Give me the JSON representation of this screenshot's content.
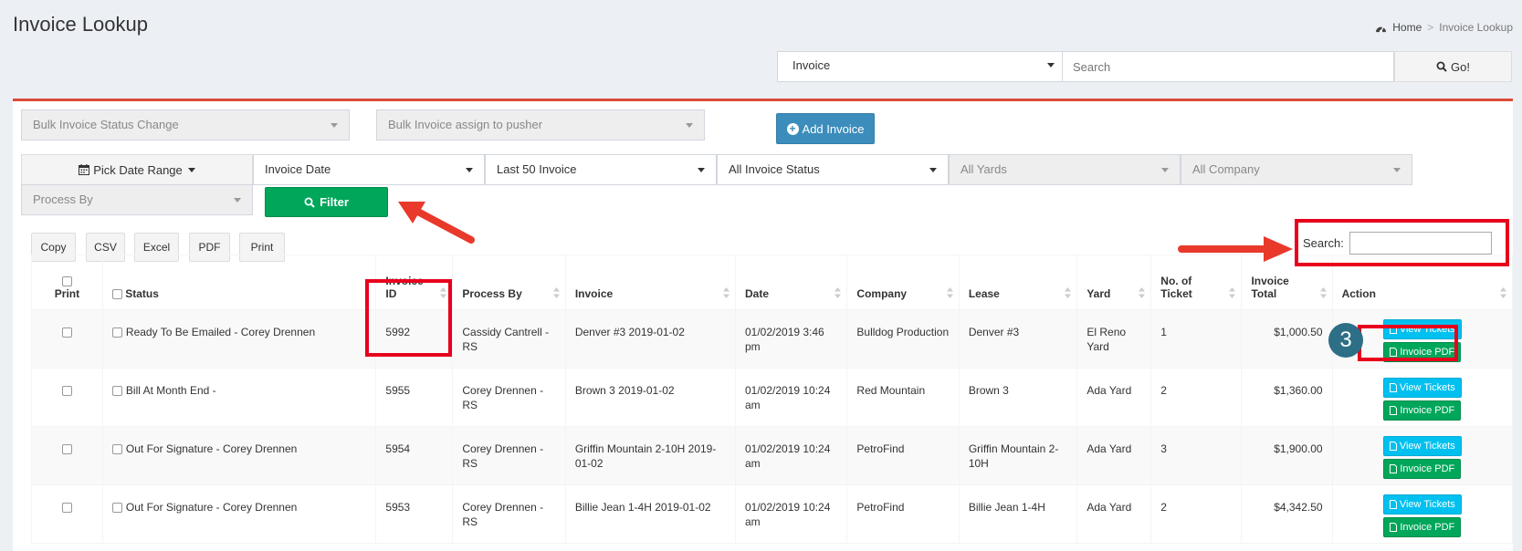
{
  "page": {
    "title": "Invoice Lookup"
  },
  "breadcrumb": {
    "home": "Home",
    "current": "Invoice Lookup"
  },
  "top_search": {
    "type_value": "Invoice",
    "placeholder": "Search",
    "go_label": "Go!"
  },
  "filters": {
    "bulk_status": "Bulk Invoice Status Change",
    "bulk_assign": "Bulk Invoice assign to pusher",
    "add_invoice": "Add Invoice",
    "pick_date": "Pick Date Range",
    "date_field": "Invoice Date",
    "limit": "Last 50 Invoice",
    "status": "All Invoice Status",
    "yards": "All Yards",
    "company": "All Company",
    "process_by": "Process By",
    "filter_label": "Filter"
  },
  "export_buttons": [
    "Copy",
    "CSV",
    "Excel",
    "PDF",
    "Print"
  ],
  "table_search": {
    "label": "Search:"
  },
  "table": {
    "headers": {
      "print": "Print",
      "status": "Status",
      "invoice_id_1": "Invoice",
      "invoice_id_2": "ID",
      "process_by": "Process By",
      "invoice": "Invoice",
      "date": "Date",
      "company": "Company",
      "lease": "Lease",
      "yard": "Yard",
      "tickets_1": "No. of",
      "tickets_2": "Ticket",
      "total_1": "Invoice",
      "total_2": "Total",
      "action": "Action"
    },
    "rows": [
      {
        "status": "Ready To Be Emailed - Corey Drennen",
        "id": "5992",
        "process_by": "Cassidy Cantrell - RS",
        "invoice": "Denver #3 2019-01-02",
        "date": "01/02/2019 3:46 pm",
        "company": "Bulldog Production",
        "lease": "Denver #3",
        "yard": "El Reno Yard",
        "tickets": "1",
        "total": "$1,000.50"
      },
      {
        "status": "Bill At Month End -",
        "id": "5955",
        "process_by": "Corey Drennen - RS",
        "invoice": "Brown 3 2019-01-02",
        "date": "01/02/2019 10:24 am",
        "company": "Red Mountain",
        "lease": "Brown 3",
        "yard": "Ada Yard",
        "tickets": "2",
        "total": "$1,360.00"
      },
      {
        "status": "Out For Signature - Corey Drennen",
        "id": "5954",
        "process_by": "Corey Drennen - RS",
        "invoice": "Griffin Mountain 2-10H 2019-01-02",
        "date": "01/02/2019 10:24 am",
        "company": "PetroFind",
        "lease": "Griffin Mountain 2-10H",
        "yard": "Ada Yard",
        "tickets": "3",
        "total": "$1,900.00"
      },
      {
        "status": "Out For Signature - Corey Drennen",
        "id": "5953",
        "process_by": "Corey Drennen - RS",
        "invoice": "Billie Jean 1-4H 2019-01-02",
        "date": "01/02/2019 10:24 am",
        "company": "PetroFind",
        "lease": "Billie Jean 1-4H",
        "yard": "Ada Yard",
        "tickets": "2",
        "total": "$4,342.50"
      }
    ],
    "view_label": "View Tickets",
    "pdf_label": "Invoice PDF"
  },
  "annotations": {
    "step": "3"
  },
  "colors": {
    "accent_red": "#dd4b39",
    "primary": "#3c8dbc",
    "success": "#00a65a",
    "info": "#00c0ef",
    "annotation": "#e8001c"
  }
}
